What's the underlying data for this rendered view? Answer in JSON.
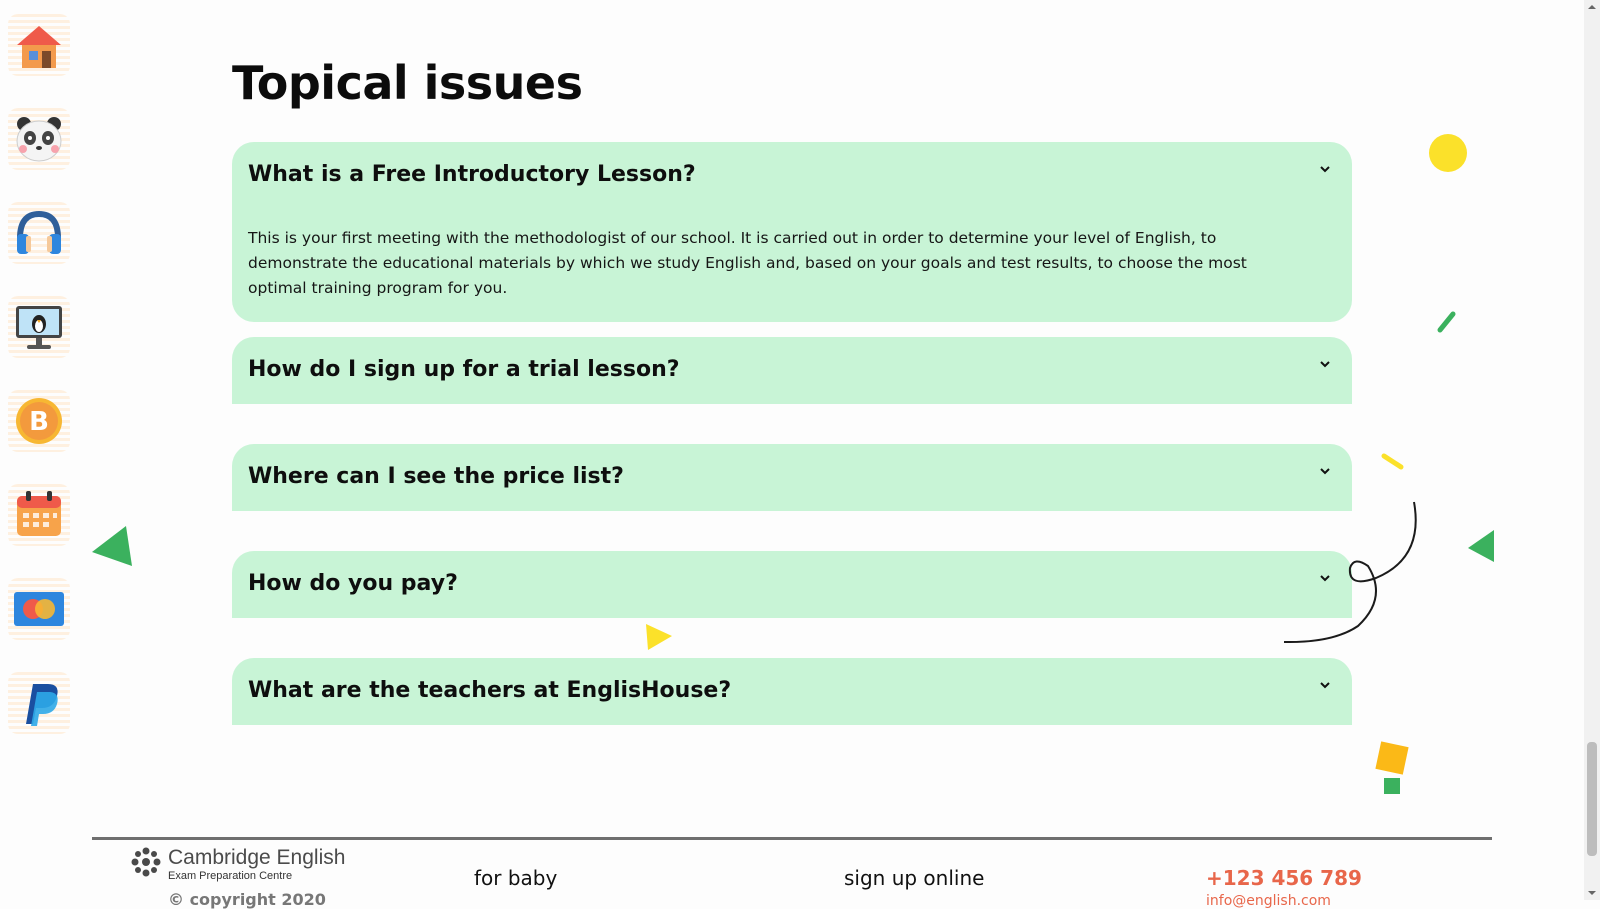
{
  "sidebar": {
    "items": [
      {
        "name": "home",
        "icon": "home-icon"
      },
      {
        "name": "panda",
        "icon": "panda-icon"
      },
      {
        "name": "audio",
        "icon": "headphones-icon"
      },
      {
        "name": "online-lessons",
        "icon": "computer-penguin-icon"
      },
      {
        "name": "bitcoin",
        "icon": "bitcoin-icon"
      },
      {
        "name": "calendar",
        "icon": "calendar-icon"
      },
      {
        "name": "mastercard",
        "icon": "mastercard-icon"
      },
      {
        "name": "paypal",
        "icon": "paypal-icon"
      }
    ]
  },
  "main": {
    "title": "Topical issues",
    "faq": [
      {
        "question": "What is a Free Introductory Lesson?",
        "answer": "This is your first meeting with the methodologist of our school. It is carried out in order to determine your level of English, to demonstrate the educational materials by which we study English and, based on your goals and test results, to choose the most optimal training program for you.",
        "expanded": true
      },
      {
        "question": "How do I sign up for a trial lesson?",
        "expanded": false
      },
      {
        "question": "Where can I see the price list?",
        "expanded": false
      },
      {
        "question": "How do you pay?",
        "expanded": false
      },
      {
        "question": "What are the teachers at EnglisHouse?",
        "expanded": false
      }
    ]
  },
  "footer": {
    "logo": {
      "brand": "Cambridge English",
      "subtitle": "Exam Preparation Centre"
    },
    "copyright": "© copyright 2020",
    "links": [
      "for baby",
      "sign up online"
    ],
    "phone": "+123 456 789",
    "email_partial": "info@english.com"
  },
  "colors": {
    "faq_background": "#c8f4d6",
    "accent_orange": "#e8664a",
    "deco_green": "#3bb15e",
    "deco_yellow": "#fbe12a"
  }
}
